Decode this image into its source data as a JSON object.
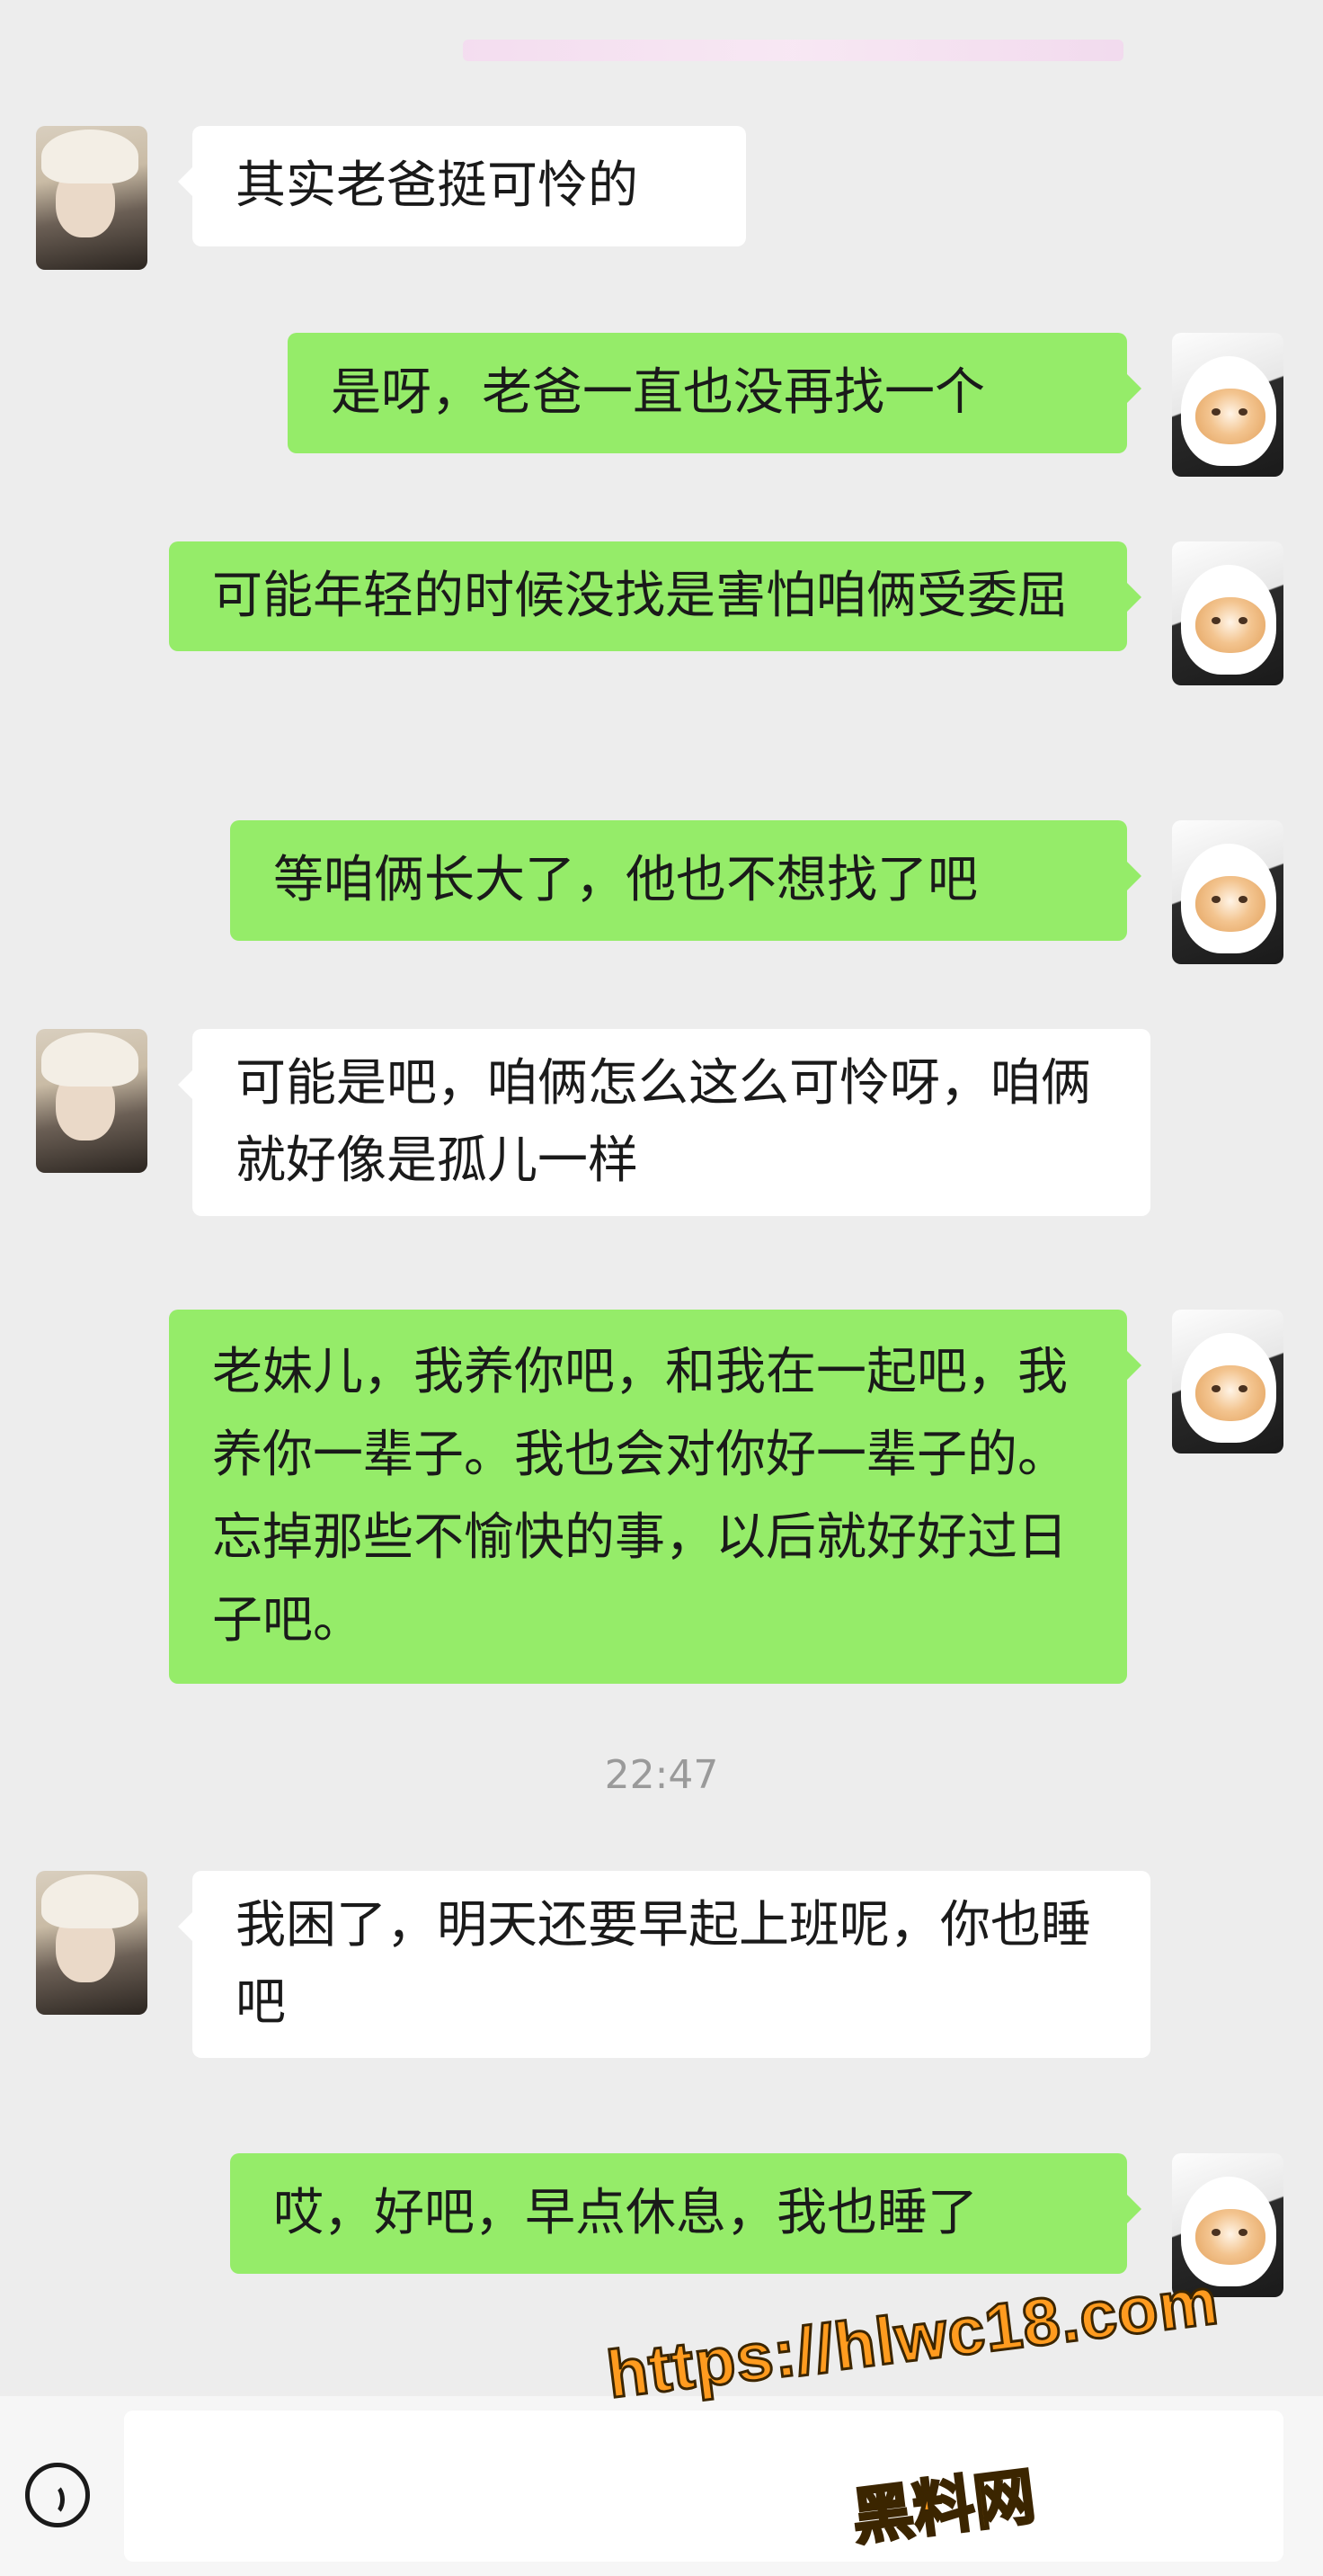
{
  "messages": [
    {
      "side": "in",
      "avatar": "female-avatar",
      "text": "其实老爸挺可怜的"
    },
    {
      "side": "out",
      "avatar": "cat-avatar",
      "text": "是呀，老爸一直也没再找一个"
    },
    {
      "side": "out",
      "avatar": "cat-avatar",
      "text": "可能年轻的时候没找是害怕咱俩受委屈"
    },
    {
      "side": "out",
      "avatar": "cat-avatar",
      "text": "等咱俩长大了，他也不想找了吧"
    },
    {
      "side": "in",
      "avatar": "female-avatar",
      "text": "可能是吧，咱俩怎么这么可怜呀，咱俩就好像是孤儿一样"
    },
    {
      "side": "out",
      "avatar": "cat-avatar",
      "text": "老妹儿，我养你吧，和我在一起吧，我养你一辈子。我也会对你好一辈子的。忘掉那些不愉快的事，以后就好好过日子吧。"
    },
    {
      "side": "in",
      "avatar": "female-avatar",
      "text": "我困了，明天还要早起上班呢，你也睡吧"
    },
    {
      "side": "out",
      "avatar": "cat-avatar",
      "text": "哎，好吧，早点休息，我也睡了"
    }
  ],
  "timestamp": "22:47",
  "watermark": {
    "url": "https://hlwc18.com",
    "site_name": "黑料网"
  },
  "colors": {
    "background": "#ededed",
    "incoming_bubble": "#ffffff",
    "outgoing_bubble": "#95ec69",
    "watermark": "#ff9b1f"
  }
}
